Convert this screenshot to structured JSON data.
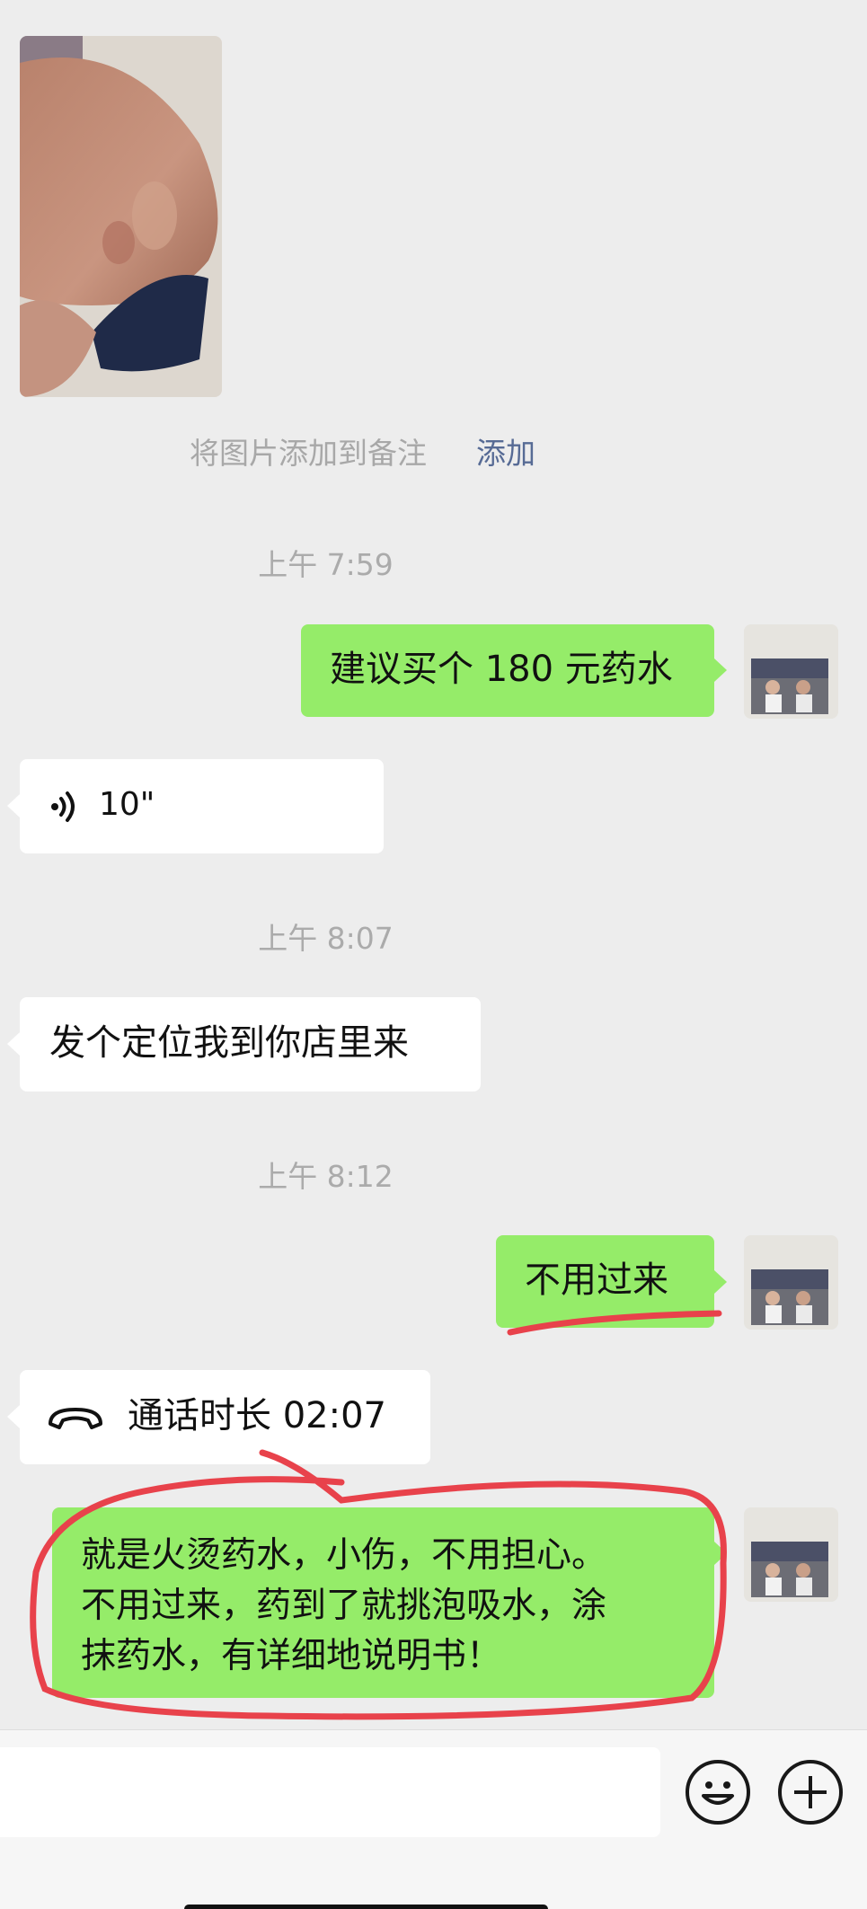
{
  "photo_note": {
    "text": "将图片添加到备注",
    "link": "添加"
  },
  "messages": [
    {
      "type": "timestamp",
      "text": "上午 7:59"
    },
    {
      "type": "text",
      "side": "right",
      "text": "建议买个 180 元药水"
    },
    {
      "type": "voice",
      "side": "left",
      "duration": "10\""
    },
    {
      "type": "timestamp",
      "text": "上午 8:07"
    },
    {
      "type": "text",
      "side": "left",
      "text": "发个定位我到你店里来"
    },
    {
      "type": "timestamp",
      "text": "上午 8:12"
    },
    {
      "type": "text",
      "side": "right",
      "text": "不用过来"
    },
    {
      "type": "call",
      "side": "left",
      "text": "通话时长 02:07"
    },
    {
      "type": "text",
      "side": "right",
      "lines": [
        "就是火烫药水，小伤，不用担心。",
        "不用过来，药到了就挑泡吸水，涂",
        "抹药水，有详细地说明书！"
      ]
    }
  ],
  "icons": {
    "voice": "voice-wave-icon",
    "call": "phone-hangup-icon",
    "emoji": "emoji-icon",
    "more": "plus-icon"
  },
  "colors": {
    "background": "#ededed",
    "my_bubble": "#95ec69",
    "other_bubble": "#ffffff",
    "link": "#576b95",
    "annotation": "#e8424b"
  }
}
